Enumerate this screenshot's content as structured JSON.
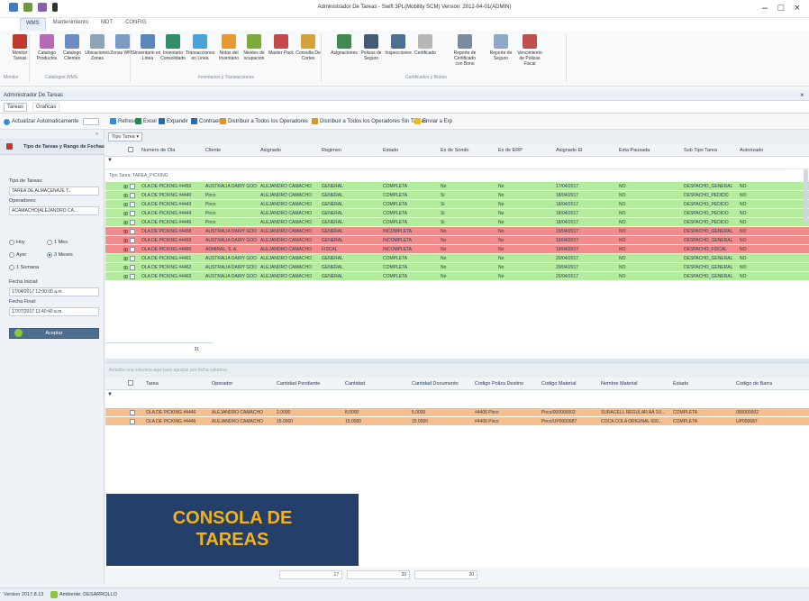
{
  "window": {
    "title": "Administrador De Tareas - Swift 3PL(Mobility SCM) Version: 2012-04-01(ADMIN)"
  },
  "menu": {
    "tabs": [
      "WMS",
      "Mantenimiento",
      "MDT",
      "CONFIG"
    ]
  },
  "ribbon": {
    "buttons": [
      "Monitor Tareas",
      "Catalogo Productos",
      "Catalogo Clientes",
      "Ubicaciones Zonas",
      "Zonas WMS",
      "Inventario en Linea",
      "Inventario Consolidado",
      "Transacciones en Linea",
      "Notas del Inventario",
      "Niveles de ocupacion",
      "Master Pack",
      "Consulta De Cortes",
      "Asignaciones",
      "Polizas de Seguro",
      "Inspecciones",
      "Certificado",
      "Reporte de Certificado con Bono",
      "Reporte de Seguro",
      "Vencimiento de Polizas Fiscal"
    ],
    "groups": [
      "Monitor",
      "Catalogos WMS",
      "Inventarios y Transacciones",
      "Certificados y Bonos"
    ]
  },
  "doc_tab": "Administrador De Tareas",
  "sub_tabs": [
    "Tareas",
    "Graficas"
  ],
  "toolbar": {
    "auto": "Actualizar Automaticamente",
    "items": [
      "Refrescar",
      "Excel",
      "Expandir",
      "Contraer",
      "Distribuir a Todos los Operadores",
      "Distribuir a Todos los Operadores Sin Tareas",
      "Enviar a Erp"
    ]
  },
  "left": {
    "title": "Tipo de Tareas y Rango de Fechas",
    "tipo_label": "Tipo de Tareas:",
    "tipo_value": "TAREA DE ALMACENAJE T...",
    "oper_label": "Operadores:",
    "oper_value": "ACAMACHO(ALEJANDRO CA...",
    "radios": [
      "Hoy",
      "1 Mes",
      "Ayer",
      "3 Meses",
      "1 Semana"
    ],
    "fi_label": "Fecha Inicial:",
    "fi_value": "17/04/2017 12:00:00 a.m.",
    "ff_label": "Fecha Final:",
    "ff_value": "17/07/2017 11:40:40 a.m.",
    "accept": "Aceptar"
  },
  "top_grid": {
    "group_chip": "Tipo Tarea",
    "columns": [
      "Numero de Ola",
      "Cliente",
      "Asignado",
      "Regimen",
      "Estado",
      "Es de Sondo",
      "Es de ERP",
      "Asignado El",
      "Esta Pausada",
      "Sub Tipo Tarea",
      "Autorizado"
    ],
    "group_row": "Tipo Tarea: TAREA_PICKING",
    "rows": [
      {
        "c": "green",
        "v": [
          "OLA DE PICKING #4450",
          "AUSTRALIA DAIRY GOO...",
          "ALEJANDRO CAMACHO",
          "GENERAL",
          "COMPLETA",
          "No",
          "No",
          "17/04/2017",
          "NO",
          "DESPACHO_GENERAL",
          "NO"
        ]
      },
      {
        "c": "green",
        "v": [
          "OLA DE PICKING #4440",
          "Pirco",
          "ALEJANDRO CAMACHO",
          "GENERAL",
          "COMPLETA",
          "Si",
          "No",
          "18/04/2017",
          "NO",
          "DESPACHO_PEDIDO",
          "NO"
        ]
      },
      {
        "c": "green",
        "v": [
          "OLA DE PICKING #4443",
          "Pirco",
          "ALEJANDRO CAMACHO",
          "GENERAL",
          "COMPLETA",
          "Si",
          "No",
          "18/04/2017",
          "NO",
          "DESPACHO_PEDIDO",
          "NO"
        ]
      },
      {
        "c": "green",
        "v": [
          "OLA DE PICKING #4444",
          "Pirco",
          "ALEJANDRO CAMACHO",
          "GENERAL",
          "COMPLETA",
          "Si",
          "No",
          "18/04/2017",
          "NO",
          "DESPACHO_PEDIDO",
          "NO"
        ]
      },
      {
        "c": "green",
        "v": [
          "OLA DE PICKING #4446",
          "Pirco",
          "ALEJANDRO CAMACHO",
          "GENERAL",
          "COMPLETA",
          "Si",
          "No",
          "18/04/2017",
          "NO",
          "DESPACHO_PEDIDO",
          "NO"
        ]
      },
      {
        "c": "red",
        "v": [
          "OLA DE PICKING #4458",
          "AUSTRALIA DAIRY GOO...",
          "ALEJANDRO CAMACHO",
          "GENERAL",
          "INCOMPLETA",
          "No",
          "No",
          "19/04/2017",
          "NO",
          "DESPACHO_GENERAL",
          "NO"
        ]
      },
      {
        "c": "red",
        "v": [
          "OLA DE PICKING #4459",
          "AUSTRALIA DAIRY GOO...",
          "ALEJANDRO CAMACHO",
          "GENERAL",
          "INCOMPLETA",
          "No",
          "No",
          "19/04/2017",
          "NO",
          "DESPACHO_GENERAL",
          "NO"
        ]
      },
      {
        "c": "red",
        "v": [
          "OLA DE PICKING #4460",
          "ADMIRAL, S. A.",
          "ALEJANDRO CAMACHO",
          "FISCAL",
          "INCOMPLETA",
          "No",
          "No",
          "19/04/2017",
          "NO",
          "DESPACHO_FISCAL",
          "NO"
        ]
      },
      {
        "c": "green",
        "v": [
          "OLA DE PICKING #4461",
          "AUSTRALIA DAIRY GOO...",
          "ALEJANDRO CAMACHO",
          "GENERAL",
          "COMPLETA",
          "No",
          "No",
          "20/04/2017",
          "NO",
          "DESPACHO_GENERAL",
          "NO"
        ]
      },
      {
        "c": "green",
        "v": [
          "OLA DE PICKING #4462",
          "AUSTRALIA DAIRY GOO...",
          "ALEJANDRO CAMACHO",
          "GENERAL",
          "COMPLETA",
          "No",
          "No",
          "20/04/2017",
          "NO",
          "DESPACHO_GENERAL",
          "NO"
        ]
      },
      {
        "c": "green",
        "v": [
          "OLA DE PICKING #4463",
          "AUSTRALIA DAIRY GOO...",
          "ALEJANDRO CAMACHO",
          "GENERAL",
          "COMPLETA",
          "No",
          "No",
          "20/04/2017",
          "NO",
          "DESPACHO_GENERAL",
          "NO"
        ]
      }
    ],
    "footer_count": "31"
  },
  "bottom_grid": {
    "drag_hint": "Arrastre una columna aqui para agrupar por dicha columna",
    "columns": [
      "Tarea",
      "Operador",
      "Cantidad Pendiente",
      "Cantidad",
      "Cantidad Documento",
      "Codigo Poliza Destino",
      "Codigo Material",
      "Nombre Material",
      "Estado",
      "Codigo de Barra"
    ],
    "rows": [
      [
        "OLA DE PICKING #4446",
        "ALEJANDRO CAMACHO",
        "2.0000",
        "8.0000",
        "5.0000",
        "#4406 Pirco",
        "Pirco/000000002",
        "SURACELL REGULAR AA 1U...",
        "COMPLETA",
        "000000002"
      ],
      [
        "OLA DE PICKING #4446",
        "ALEJANDRO CAMACHO",
        "15.0000",
        "15.0000",
        "15.0000",
        "#4406 Pirco",
        "Pirco/UP0000687",
        "COCA COLA ORIGINAL 600...",
        "COMPLETA",
        "UP000687"
      ]
    ],
    "footer": [
      "17",
      "20",
      "20"
    ]
  },
  "banner": {
    "line1": "CONSOLA DE",
    "line2": "TAREAS"
  },
  "status": {
    "version": "Version 2017.8.13",
    "ambiente": "Ambiente: DESARROLLO"
  },
  "colors": {
    "complete": "#b4ec9d",
    "incomplete": "#f28b8b",
    "detail": "#f7be8e",
    "banner": "#24406a",
    "banner_text": "#f2b21a"
  }
}
